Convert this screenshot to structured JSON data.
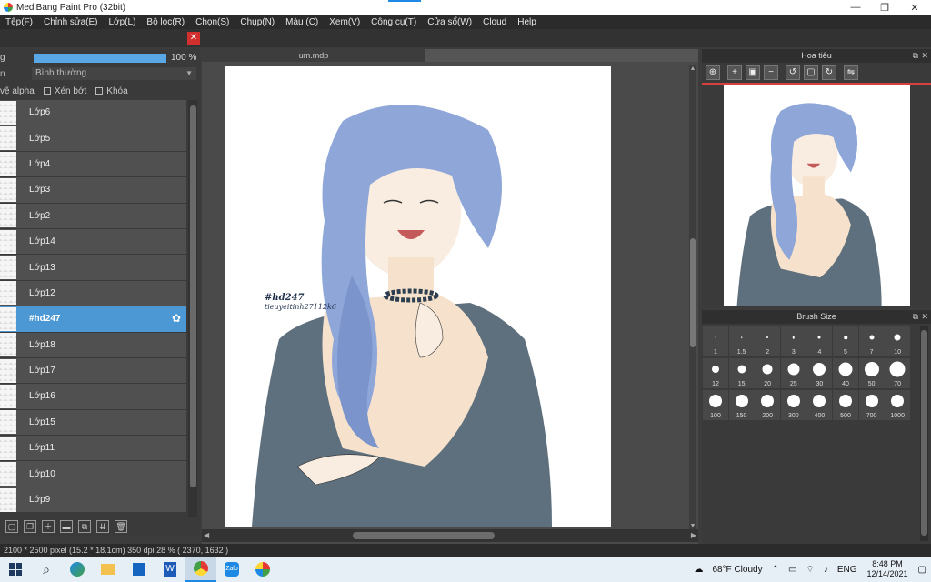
{
  "window": {
    "title": "MediBang Paint Pro (32bit)",
    "minimize": "—",
    "restore": "❐",
    "close": "✕"
  },
  "menu": [
    "Tệp(F)",
    "Chỉnh sửa(E)",
    "Lớp(L)",
    "Bộ lọc(R)",
    "Chọn(S)",
    "Chụp(N)",
    "Màu (C)",
    "Xem(V)",
    "Công cụ(T)",
    "Cửa sổ(W)",
    "Cloud",
    "Help"
  ],
  "layer_panel": {
    "opacity_label": "g",
    "opacity_value": "100 %",
    "opacity_level": 1.0,
    "blend_label": "n",
    "blend_mode": "Bình thường",
    "check_alpha": "vệ alpha",
    "check_clip": "Xén bớt",
    "check_lock": "Khóa",
    "layers": [
      "Lớp6",
      "Lớp5",
      "Lớp4",
      "Lớp3",
      "Lớp2",
      "Lớp14",
      "Lớp13",
      "Lớp12",
      "#hd247",
      "Lớp18",
      "Lớp17",
      "Lớp16",
      "Lớp15",
      "Lớp11",
      "Lớp10",
      "Lớp9"
    ],
    "selected_layer": "#hd247"
  },
  "document": {
    "tab_name": "um.mdp",
    "watermark_line1": "#hd247",
    "watermark_line2": "tieuyeitinh27112k6"
  },
  "navigator": {
    "title": "Hoa tiêu",
    "tools": [
      "zoom-fit-icon",
      "zoom-in-icon",
      "fit-screen-icon",
      "zoom-out-icon",
      "rotate-left-icon",
      "actual-size-icon",
      "rotate-right-icon",
      "flip-icon"
    ]
  },
  "brush_size": {
    "title": "Brush Size",
    "sizes": [
      "1",
      "1.5",
      "2",
      "3",
      "4",
      "5",
      "7",
      "10",
      "12",
      "15",
      "20",
      "25",
      "30",
      "40",
      "50",
      "70",
      "100",
      "150",
      "200",
      "300",
      "400",
      "500",
      "700",
      "1000"
    ]
  },
  "status": {
    "text": "2100 * 2500 pixel  (15.2 * 18.1cm)  350 dpi  28 %  ( 2370, 1632 )"
  },
  "taskbar": {
    "weather": "68°F  Cloudy",
    "lang": "ENG",
    "time": "8:48 PM",
    "date": "12/14/2021"
  },
  "colors": {
    "accent": "#4c98d4",
    "hair": "#8fa6d8",
    "coat": "#5e6f7d",
    "skin": "#f6e2cc"
  }
}
